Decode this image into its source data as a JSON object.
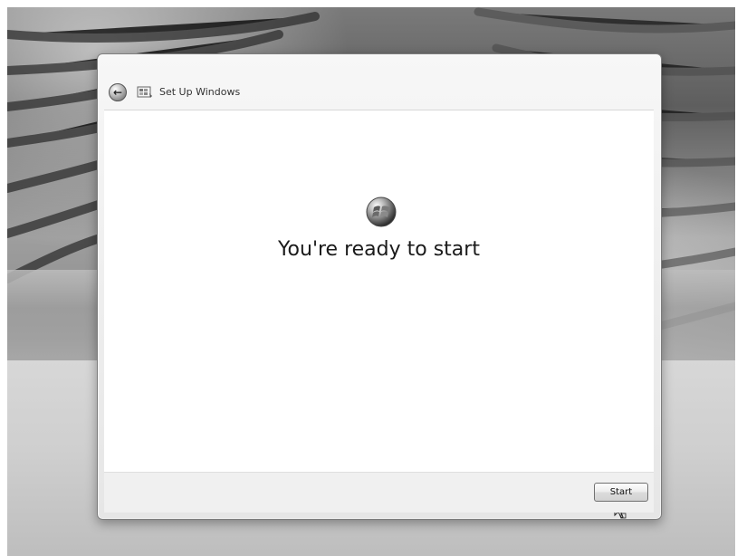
{
  "window": {
    "title": "Set Up Windows"
  },
  "main": {
    "heading": "You're ready to start"
  },
  "footer": {
    "start_label": "Start"
  },
  "icons": {
    "back": "back-arrow-icon",
    "setup": "setup-windows-icon",
    "logo": "windows-logo-icon",
    "cursor": "mouse-cursor-icon"
  }
}
